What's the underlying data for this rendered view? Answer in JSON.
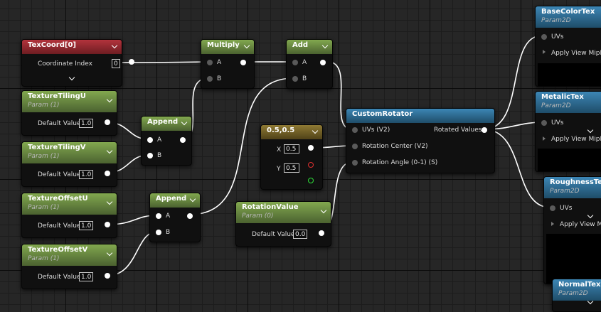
{
  "nodes": {
    "texcoord": {
      "title": "TexCoord[0]",
      "row_label": "Coordinate Index",
      "value": "0"
    },
    "tiling_u": {
      "title": "TextureTilingU",
      "subtitle": "Param (1)",
      "row_label": "Default Value",
      "value": "1.0"
    },
    "tiling_v": {
      "title": "TextureTilingV",
      "subtitle": "Param (1)",
      "row_label": "Default Value",
      "value": "1.0"
    },
    "offset_u": {
      "title": "TextureOffsetU",
      "subtitle": "Param (1)",
      "row_label": "Default Value",
      "value": "1.0"
    },
    "offset_v": {
      "title": "TextureOffsetV",
      "subtitle": "Param (1)",
      "row_label": "Default Value",
      "value": "1.0"
    },
    "append1": {
      "title": "Append",
      "pin_a": "A",
      "pin_b": "B"
    },
    "append2": {
      "title": "Append",
      "pin_a": "A",
      "pin_b": "B"
    },
    "multiply": {
      "title": "Multiply",
      "pin_a": "A",
      "pin_b": "B"
    },
    "add": {
      "title": "Add",
      "pin_a": "A",
      "pin_b": "B"
    },
    "const2": {
      "title": "0.5,0.5",
      "x_label": "X",
      "x_value": "0.5",
      "y_label": "Y",
      "y_value": "0.5"
    },
    "rotation": {
      "title": "RotationValue",
      "subtitle": "Param (0)",
      "row_label": "Default Value",
      "value": "0.0"
    },
    "rotator": {
      "title": "CustomRotator",
      "in_uvs": "UVs (V2)",
      "in_center": "Rotation Center (V2)",
      "in_angle": "Rotation Angle (0-1) (S)",
      "out": "Rotated Values"
    },
    "basecolor": {
      "title": "BaseColorTex",
      "subtitle": "Param2D",
      "uvs": "UVs",
      "mip": "Apply View MipBias"
    },
    "metalic": {
      "title": "MetalicTex",
      "subtitle": "Param2D",
      "uvs": "UVs",
      "mip": "Apply View MipBias"
    },
    "roughness": {
      "title": "RoughnessTex",
      "subtitle": "Param2D",
      "uvs": "UVs",
      "mip": "Apply View MipBias"
    },
    "normal": {
      "title": "NormalTex",
      "subtitle": "Param2D"
    }
  },
  "icons": [
    "chevron-down-icon",
    "pin-connected",
    "pin-disconnected",
    "exec-arrow-icon"
  ],
  "colors": {
    "canvas": "#262626",
    "header_red": "#b3333c",
    "header_green": "#82a84f",
    "header_blue": "#3c86b5",
    "header_gold": "#8f7a34",
    "wire": "#ffffff"
  }
}
